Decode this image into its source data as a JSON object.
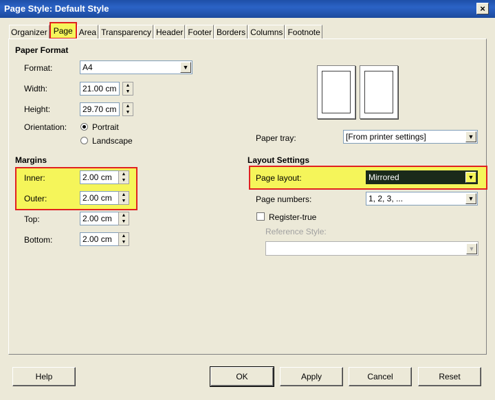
{
  "window": {
    "title": "Page Style: Default Style",
    "close_glyph": "×"
  },
  "tabs": [
    {
      "label": "Organizer"
    },
    {
      "label": "Page"
    },
    {
      "label": "Area"
    },
    {
      "label": "Transparency"
    },
    {
      "label": "Header"
    },
    {
      "label": "Footer"
    },
    {
      "label": "Borders"
    },
    {
      "label": "Columns"
    },
    {
      "label": "Footnote"
    }
  ],
  "paper_format": {
    "title": "Paper Format",
    "format_label": "Format:",
    "format_value": "A4",
    "width_label": "Width:",
    "width_value": "21.00 cm",
    "height_label": "Height:",
    "height_value": "29.70 cm",
    "orientation_label": "Orientation:",
    "portrait_label": "Portrait",
    "landscape_label": "Landscape",
    "orientation_selected": "Portrait",
    "paper_tray_label": "Paper tray:",
    "paper_tray_value": "[From printer settings]"
  },
  "margins": {
    "title": "Margins",
    "inner_label": "Inner:",
    "inner_value": "2.00 cm",
    "outer_label": "Outer:",
    "outer_value": "2.00 cm",
    "top_label": "Top:",
    "top_value": "2.00 cm",
    "bottom_label": "Bottom:",
    "bottom_value": "2.00 cm"
  },
  "layout_settings": {
    "title": "Layout Settings",
    "page_layout_label": "Page layout:",
    "page_layout_value": "Mirrored",
    "page_numbers_label": "Page numbers:",
    "page_numbers_value": "1, 2, 3, ...",
    "register_true_label": "Register-true",
    "register_true_checked": false,
    "reference_style_label": "Reference Style:",
    "reference_style_value": ""
  },
  "buttons": {
    "help": "Help",
    "ok": "OK",
    "apply": "Apply",
    "cancel": "Cancel",
    "reset": "Reset"
  },
  "colors": {
    "dialog_bg": "#ece9d8",
    "titlebar": "#2b63c6",
    "highlight": "#f5f55a",
    "highlight_border": "#e02020",
    "selected_dark": "#1a2a1a"
  }
}
